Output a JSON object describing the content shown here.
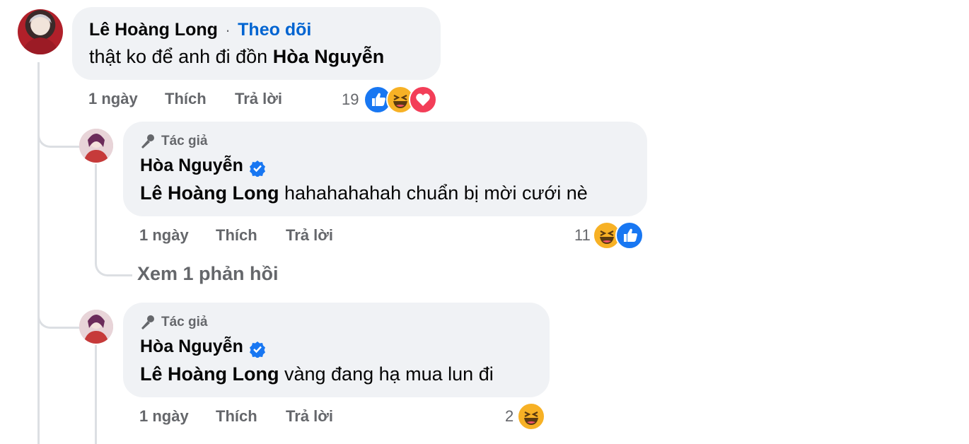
{
  "comment": {
    "author": "Lê Hoàng Long",
    "separator": "·",
    "follow_label": "Theo dõi",
    "text_prefix": "thật ko để anh đi đồn ",
    "mention": "Hòa Nguyễn",
    "time": "1 ngày",
    "like_label": "Thích",
    "reply_label": "Trả lời",
    "reaction_count": "19",
    "reactions": [
      "like-icon",
      "haha-icon",
      "love-icon"
    ]
  },
  "replies": [
    {
      "author_tag": "Tác giả",
      "author": "Hòa Nguyễn",
      "mention": "Lê Hoàng Long",
      "text": " hahahahahah chuẩn bị mời cưới nè",
      "time": "1 ngày",
      "like_label": "Thích",
      "reply_label": "Trả lời",
      "reaction_count": "11",
      "reactions": [
        "haha-icon",
        "like-icon"
      ],
      "view_replies": "Xem 1 phản hồi"
    },
    {
      "author_tag": "Tác giả",
      "author": "Hòa Nguyễn",
      "mention": "Lê Hoàng Long",
      "text": " vàng đang hạ mua lun đi",
      "time": "1 ngày",
      "like_label": "Thích",
      "reply_label": "Trả lời",
      "reaction_count": "2",
      "reactions": [
        "haha-icon"
      ]
    }
  ],
  "colors": {
    "bubble": "#f0f2f5",
    "link_blue": "#0064d1",
    "meta_gray": "#65676b",
    "like_blue": "#1877f2",
    "love_red": "#f33e58",
    "haha_yellow": "#f7b125",
    "verified_blue": "#1877f2"
  }
}
